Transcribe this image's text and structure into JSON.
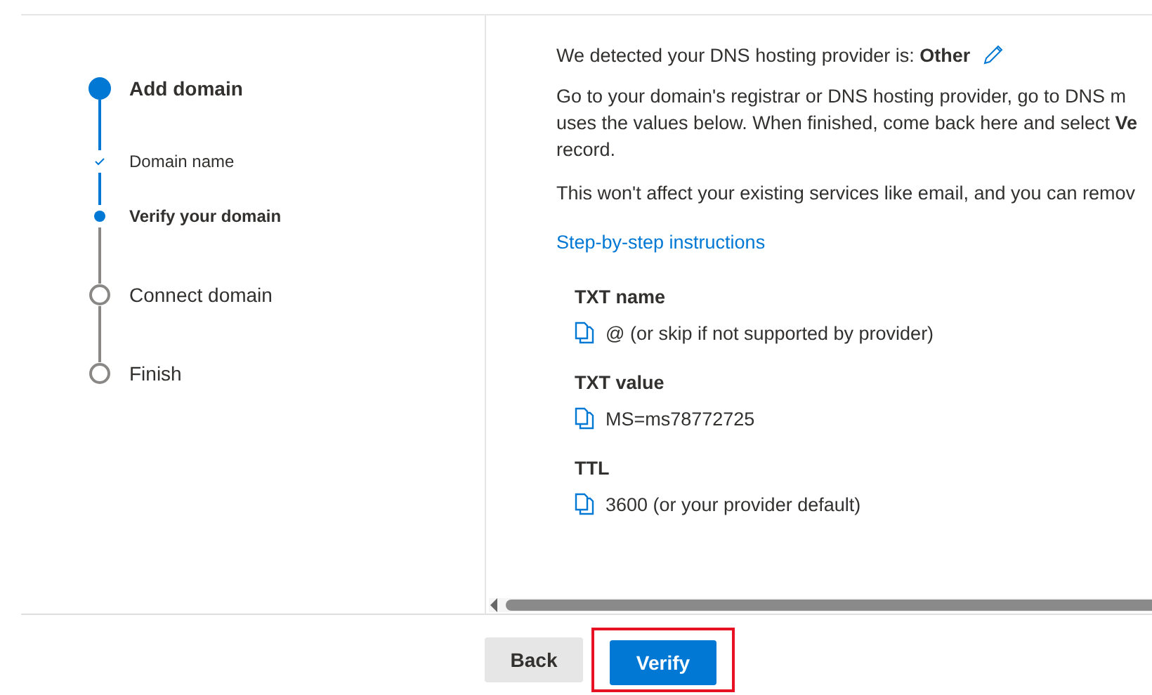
{
  "steps": [
    {
      "label": "Add domain",
      "kind": "major",
      "completed": false,
      "current": true
    },
    {
      "label": "Domain name",
      "kind": "minor",
      "completed": true,
      "current": false
    },
    {
      "label": "Verify your domain",
      "kind": "minor",
      "completed": false,
      "current": true
    },
    {
      "label": "Connect domain",
      "kind": "major",
      "completed": false,
      "current": false
    },
    {
      "label": "Finish",
      "kind": "major",
      "completed": false,
      "current": false
    }
  ],
  "content": {
    "provider_text": "We detected your DNS hosting provider is: **Other**",
    "instructions": [
      "Go to your domain's registrar or DNS hosting provider, go to DNS m",
      "uses the values below. When finished, come back here and select **Ve**",
      "record."
    ],
    "note": "This won't affect your existing services like email, and you can remov",
    "link": "Step-by-step instructions",
    "records": [
      {
        "label": "TXT name",
        "value": "@ (or skip if not supported by provider)"
      },
      {
        "label": "TXT value",
        "value": "MS=ms78772725"
      },
      {
        "label": "TTL",
        "value": "3600 (or your provider default)"
      }
    ]
  },
  "buttons": [
    {
      "label": "Back",
      "kind": "secondary",
      "highlighted": false
    },
    {
      "label": "Verify",
      "kind": "primary",
      "highlighted": true
    }
  ]
}
